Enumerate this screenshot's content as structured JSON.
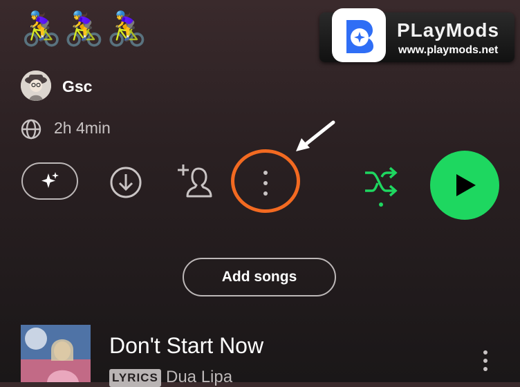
{
  "playlist": {
    "title": "🚴‍♀️🚴‍♀️🚴‍♀️",
    "owner": "Gsc",
    "duration": "2h 4min"
  },
  "watermark": {
    "title": "PLayMods",
    "url": "www.playmods.net"
  },
  "actions": {
    "enhance_icon": "sparkle-icon",
    "download_icon": "download-icon",
    "add_collaborator_icon": "add-person-icon",
    "more_icon": "more-vertical-icon",
    "shuffle_icon": "shuffle-icon",
    "play_icon": "play-icon"
  },
  "add_songs_label": "Add songs",
  "tracks": [
    {
      "title": "Don't Start Now",
      "badge": "LYRICS",
      "artist": "Dua Lipa"
    }
  ],
  "colors": {
    "accent_green": "#1ed760",
    "highlight_orange": "#f36a21",
    "background": "#2a2022"
  }
}
